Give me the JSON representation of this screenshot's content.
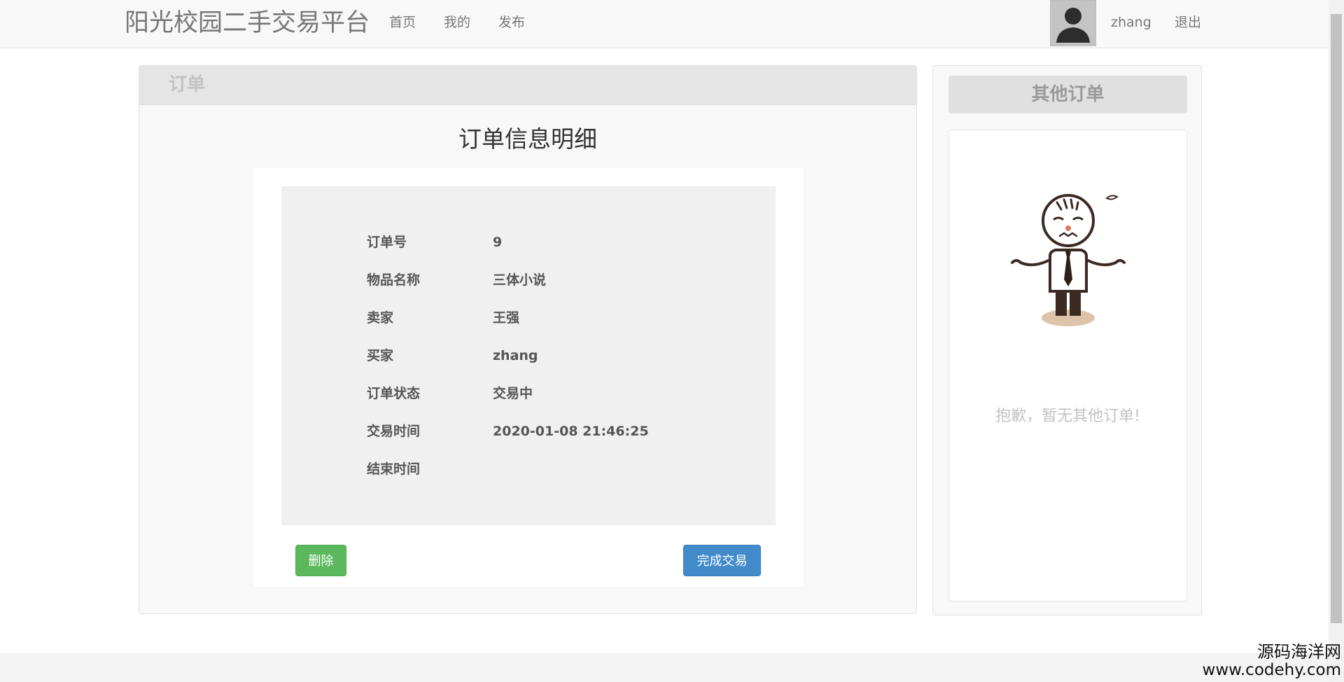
{
  "navbar": {
    "brand": "阳光校园二手交易平台",
    "links": [
      "首页",
      "我的",
      "发布"
    ],
    "username": "zhang",
    "logout": "退出"
  },
  "main": {
    "panel_title": "订单",
    "detail_title": "订单信息明细",
    "fields": [
      {
        "label": "订单号",
        "value": "9"
      },
      {
        "label": "物品名称",
        "value": "三体小说"
      },
      {
        "label": "卖家",
        "value": "王强"
      },
      {
        "label": "买家",
        "value": "zhang"
      },
      {
        "label": "订单状态",
        "value": "交易中"
      },
      {
        "label": "交易时间",
        "value": "2020-01-08 21:46:25"
      },
      {
        "label": "结束时间",
        "value": ""
      }
    ],
    "delete_button": "删除",
    "complete_button": "完成交易"
  },
  "side": {
    "title": "其他订单",
    "empty_message": "抱歉，暂无其他订单!"
  },
  "watermark": {
    "line1": "源码海洋网",
    "line2": "www.codehy.com"
  },
  "colors": {
    "success": "#5cb85c",
    "primary": "#428bca"
  }
}
